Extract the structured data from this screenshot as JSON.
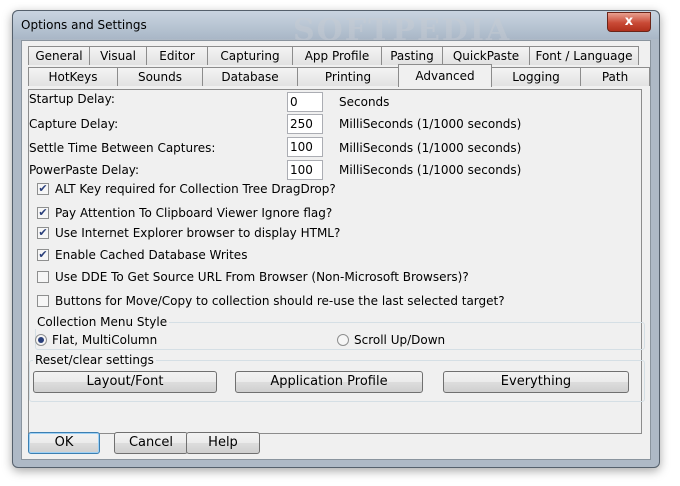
{
  "window": {
    "title": "Options and Settings",
    "close_glyph": "x"
  },
  "tabs_row1": [
    "General",
    "Visual",
    "Editor",
    "Capturing",
    "App Profile",
    "Pasting",
    "QuickPaste",
    "Font / Language"
  ],
  "tabs_row2": [
    "HotKeys",
    "Sounds",
    "Database",
    "Printing",
    "Advanced",
    "Logging",
    "Path"
  ],
  "active_tab": "Advanced",
  "delays": [
    {
      "label": "Startup Delay:",
      "value": "0",
      "unit": "Seconds"
    },
    {
      "label": "Capture Delay:",
      "value": "250",
      "unit": "MilliSeconds (1/1000 seconds)"
    },
    {
      "label": "Settle Time Between Captures:",
      "value": "100",
      "unit": "MilliSeconds (1/1000 seconds)"
    },
    {
      "label": "PowerPaste Delay:",
      "value": "100",
      "unit": "MilliSeconds (1/1000 seconds)"
    }
  ],
  "checkboxes": [
    {
      "label": "ALT Key required for Collection Tree DragDrop?",
      "checked": true
    },
    {
      "label": "Pay Attention To Clipboard Viewer Ignore flag?",
      "checked": true
    },
    {
      "label": "Use Internet Explorer browser to display HTML?",
      "checked": true
    },
    {
      "label": "Enable Cached Database Writes",
      "checked": true
    },
    {
      "label": "Use DDE To Get Source URL From Browser (Non-Microsoft Browsers)?",
      "checked": false
    },
    {
      "label": "Buttons for Move/Copy to collection should re-use the last selected target?",
      "checked": false
    }
  ],
  "collection_menu": {
    "title": "Collection Menu Style",
    "options": [
      {
        "label": "Flat, MultiColumn",
        "selected": true
      },
      {
        "label": "Scroll Up/Down",
        "selected": false
      }
    ]
  },
  "reset": {
    "title": "Reset/clear settings",
    "buttons": [
      "Layout/Font",
      "Application Profile",
      "Everything"
    ]
  },
  "footer_buttons": {
    "ok": "OK",
    "cancel": "Cancel",
    "help": "Help"
  },
  "watermark": {
    "text": "SOFTPEDIA"
  }
}
